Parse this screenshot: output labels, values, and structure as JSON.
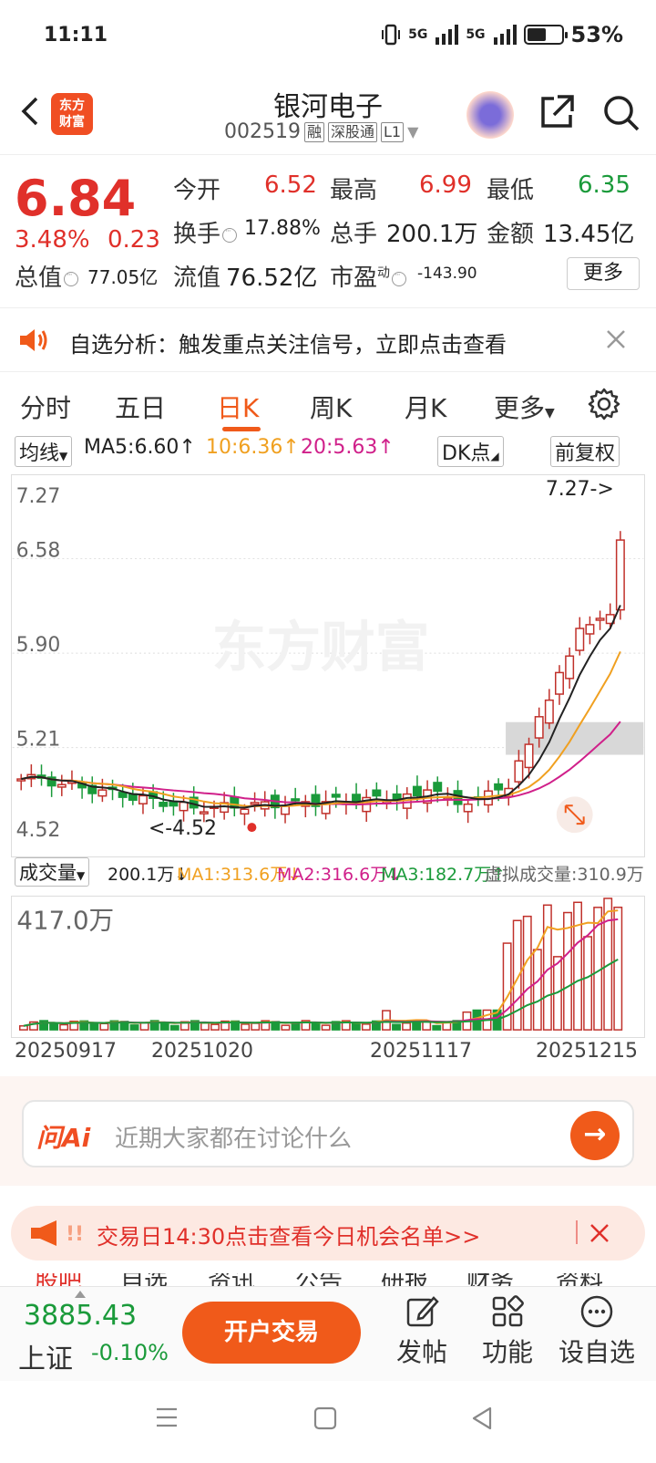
{
  "status_bar": {
    "time": "11:11",
    "network1": "5G",
    "network2": "5G",
    "battery": "53%"
  },
  "header": {
    "title": "银河电子",
    "code": "002519",
    "tags": [
      "融",
      "深股通",
      "L1"
    ]
  },
  "quote": {
    "price": "6.84",
    "pct_change": "3.48%",
    "change": "0.23",
    "open_label": "今开",
    "open": "6.52",
    "high_label": "最高",
    "high": "6.99",
    "low_label": "最低",
    "low": "6.35",
    "turnover_label": "换手",
    "turnover": "17.88%",
    "volume_label": "总手",
    "volume": "200.1万",
    "amount_label": "金额",
    "amount": "13.45亿",
    "mktcap_label": "总值",
    "mktcap": "77.05亿",
    "float_label": "流值",
    "float_cap": "76.52亿",
    "pe_label": "市盈",
    "pe_sup": "动",
    "pe": "-143.90",
    "more_label": "更多"
  },
  "notice": {
    "text": "自选分析：触发重点关注信号，立即点击查看"
  },
  "tabs": {
    "items": [
      "分时",
      "五日",
      "日K",
      "周K",
      "月K",
      "更多"
    ],
    "active": "日K"
  },
  "ma_line": {
    "dropdown": "均线",
    "ma5": "MA5:6.60",
    "ma10": "10:6.36",
    "ma20": "20:5.63",
    "dk": "DK点",
    "adjust": "前复权"
  },
  "kchart": {
    "watermark": "东方财富",
    "y_labels": [
      "7.27",
      "6.58",
      "5.90",
      "5.21",
      "4.52"
    ],
    "max_label": "7.27->",
    "min_label": "<-4.52"
  },
  "volume": {
    "dropdown": "成交量",
    "vol": "200.1万",
    "ma1": "MA1:313.6万",
    "ma2": "MA2:316.6万",
    "ma3": "MA3:182.7万",
    "virtual": "虚拟成交量:310.9万",
    "max_label": "417.0万"
  },
  "dates": [
    "20250917",
    "20251020",
    "20251117",
    "20251215"
  ],
  "ai": {
    "logo": "问Ai",
    "placeholder": "近期大家都在讨论什么"
  },
  "banner": {
    "text": "交易日14:30点击查看今日机会名单>>"
  },
  "subtabs": [
    "股吧",
    "自选",
    "资讯",
    "公告",
    "研报",
    "财务",
    "资料"
  ],
  "bottom": {
    "index_value": "3885.43",
    "index_name": "上证",
    "index_pct": "-0.10%",
    "open_account": "开户交易",
    "post": "发帖",
    "functions": "功能",
    "add_watch": "设自选"
  },
  "colors": {
    "up": "#e0302a",
    "down": "#1a9a3a",
    "accent": "#f05a1a",
    "ma5": "#222222",
    "ma10": "#f0a020",
    "ma20": "#d0208a"
  },
  "chart_data": {
    "type": "candlestick",
    "y_range": [
      4.52,
      7.27
    ],
    "last_close": 6.84,
    "ma5": 6.6,
    "ma10": 6.36,
    "ma20": 5.63,
    "max_volume": "417.0万"
  }
}
